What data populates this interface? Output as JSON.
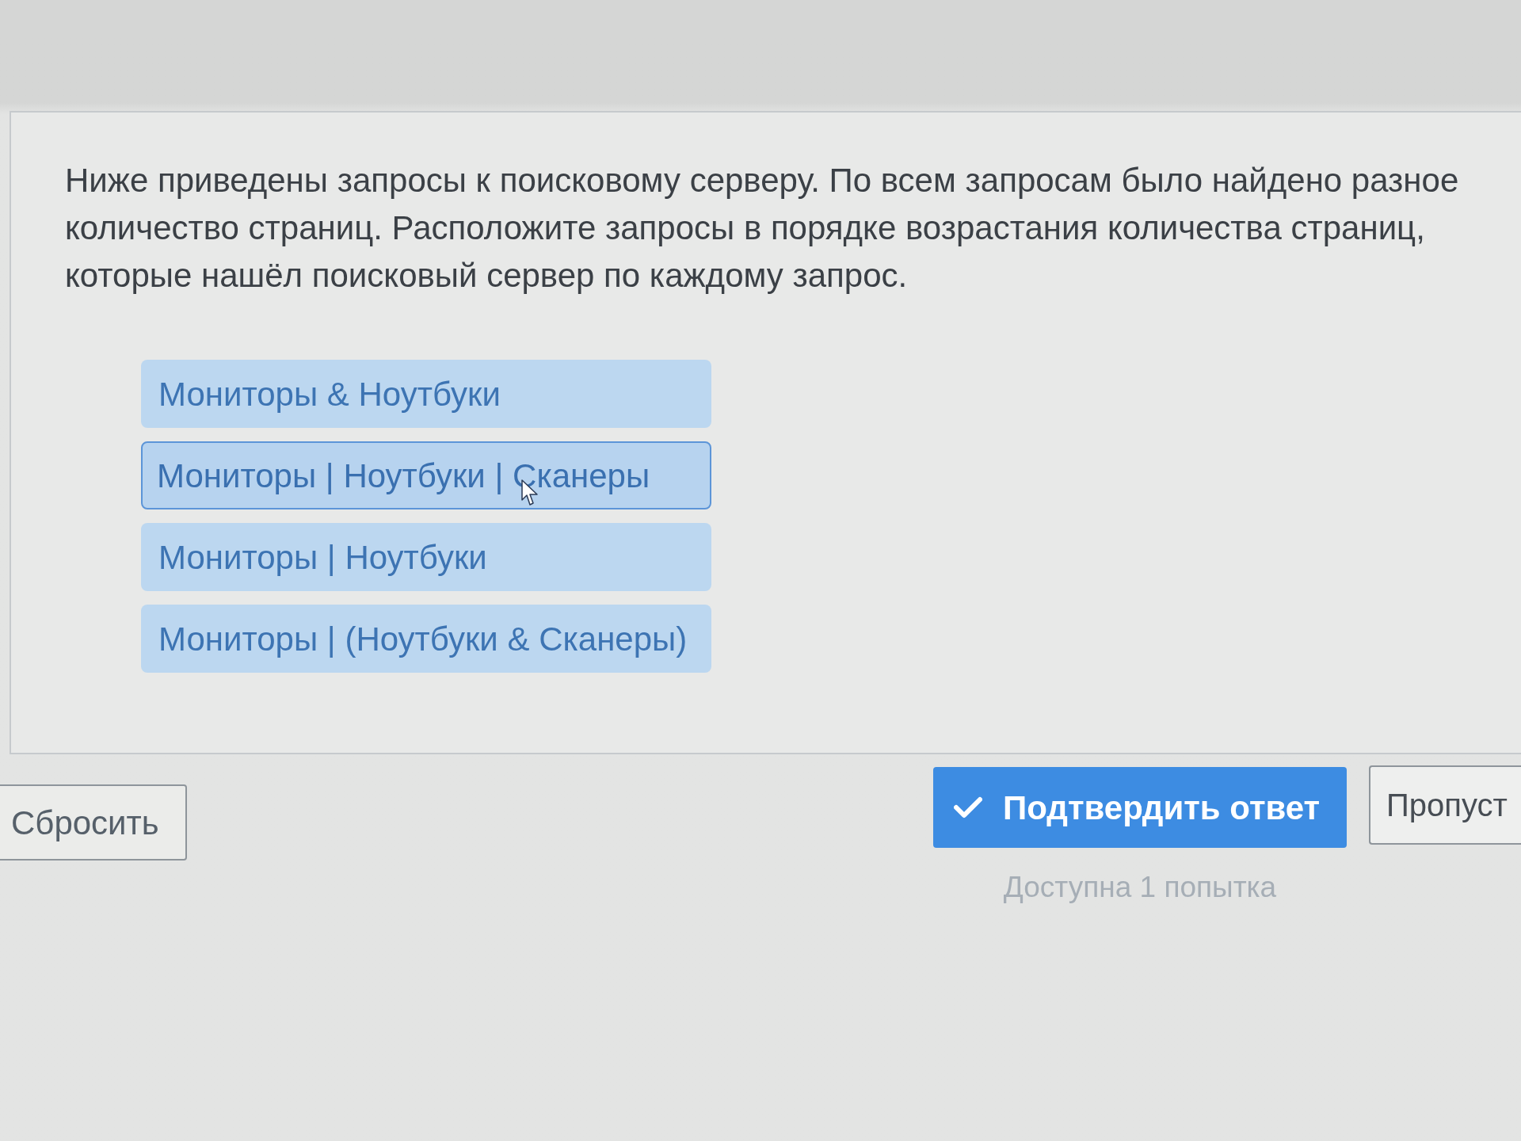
{
  "question": {
    "text": "Ниже приведены запросы к поисковому серверу. По всем запросам было найдено разное количество страниц. Расположите запросы в порядке возрастания количества страниц, которые нашёл поисковый сервер по каждому запрос."
  },
  "answer_items": [
    {
      "label": "Мониторы & Ноутбуки",
      "hovered": false
    },
    {
      "label": "Мониторы | Ноутбуки | Сканеры",
      "hovered": true
    },
    {
      "label": "Мониторы | Ноутбуки",
      "hovered": false
    },
    {
      "label": "Мониторы | (Ноутбуки & Сканеры)",
      "hovered": false
    }
  ],
  "buttons": [
    {
      "kind": "reset",
      "label": "Сбросить"
    },
    {
      "kind": "submit",
      "label": "Подтвердить ответ"
    },
    {
      "kind": "skip",
      "label": "Пропуст"
    }
  ],
  "attempts_note": "Доступна 1 попытка"
}
